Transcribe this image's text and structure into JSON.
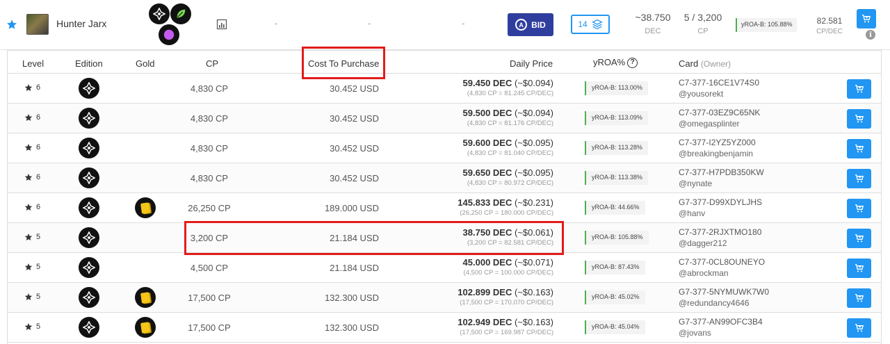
{
  "header": {
    "card_name": "Hunter Jarx",
    "dashes": [
      "-",
      "-",
      "-"
    ],
    "bid_label": "BID",
    "bid_badge": "A",
    "stack_count": "14",
    "price_dec": "~38.750",
    "price_dec_unit": "DEC",
    "cp_progress": "5 / 3,200",
    "cp_unit": "CP",
    "yroa": "yROA-B: 105.88%",
    "cp_per_dec": "82.581",
    "cp_per_dec_unit": "CP/DEC",
    "info_glyph": "i"
  },
  "columns": {
    "level": "Level",
    "edition": "Edition",
    "gold": "Gold",
    "cp": "CP",
    "cost": "Cost To Purchase",
    "daily_price": "Daily Price",
    "yroa": "yROA%",
    "yroa_help": "?",
    "card": "Card",
    "owner": "(Owner)"
  },
  "rows": [
    {
      "level": "6",
      "gold": false,
      "cp": "4,830 CP",
      "cost": "30.452 USD",
      "price": "59.450 DEC",
      "usd": "(~$0.094)",
      "sub": "(4,830 CP = 81.245 CP/DEC)",
      "yroa": "yROA-B: 113.00%",
      "card": "C7-377-16CE1V74S0",
      "owner": "@yousorekt"
    },
    {
      "level": "6",
      "gold": false,
      "cp": "4,830 CP",
      "cost": "30.452 USD",
      "price": "59.500 DEC",
      "usd": "(~$0.094)",
      "sub": "(4,830 CP = 81.176 CP/DEC)",
      "yroa": "yROA-B: 113.09%",
      "card": "C7-377-03EZ9C65NK",
      "owner": "@omegasplinter"
    },
    {
      "level": "6",
      "gold": false,
      "cp": "4,830 CP",
      "cost": "30.452 USD",
      "price": "59.600 DEC",
      "usd": "(~$0.095)",
      "sub": "(4,830 CP = 81.040 CP/DEC)",
      "yroa": "yROA-B: 113.28%",
      "card": "C7-377-I2YZ5YZ000",
      "owner": "@breakingbenjamin"
    },
    {
      "level": "6",
      "gold": false,
      "cp": "4,830 CP",
      "cost": "30.452 USD",
      "price": "59.650 DEC",
      "usd": "(~$0.095)",
      "sub": "(4,830 CP = 80.972 CP/DEC)",
      "yroa": "yROA-B: 113.38%",
      "card": "C7-377-H7PDB350KW",
      "owner": "@nynate"
    },
    {
      "level": "6",
      "gold": true,
      "cp": "26,250 CP",
      "cost": "189.000 USD",
      "price": "145.833 DEC",
      "usd": "(~$0.231)",
      "sub": "(26,250 CP = 180.000 CP/DEC)",
      "yroa": "yROA-B: 44.66%",
      "card": "G7-377-D99XDYLJHS",
      "owner": "@hanv"
    },
    {
      "level": "5",
      "gold": false,
      "cp": "3,200 CP",
      "cost": "21.184 USD",
      "price": "38.750 DEC",
      "usd": "(~$0.061)",
      "sub": "(3,200 CP = 82.581 CP/DEC)",
      "yroa": "yROA-B: 105.88%",
      "card": "C7-377-2RJXTMO180",
      "owner": "@dagger212"
    },
    {
      "level": "5",
      "gold": false,
      "cp": "4,500 CP",
      "cost": "21.184 USD",
      "price": "45.000 DEC",
      "usd": "(~$0.071)",
      "sub": "(4,500 CP = 100.000 CP/DEC)",
      "yroa": "yROA-B: 87.43%",
      "card": "C7-377-0CL8OUNEYO",
      "owner": "@abrockman"
    },
    {
      "level": "5",
      "gold": true,
      "cp": "17,500 CP",
      "cost": "132.300 USD",
      "price": "102.899 DEC",
      "usd": "(~$0.163)",
      "sub": "(17,500 CP = 170.070 CP/DEC)",
      "yroa": "yROA-B: 45.02%",
      "card": "G7-377-5NYMUWK7W0",
      "owner": "@redundancy4646"
    },
    {
      "level": "5",
      "gold": true,
      "cp": "17,500 CP",
      "cost": "132.300 USD",
      "price": "102.949 DEC",
      "usd": "(~$0.163)",
      "sub": "(17,500 CP = 169.987 CP/DEC)",
      "yroa": "yROA-B: 45.04%",
      "card": "G7-377-AN99OFC3B4",
      "owner": "@jovans"
    }
  ],
  "colors": {
    "accent": "#2196f3",
    "bid": "#2f3e9e",
    "highlight": "#e31b1b",
    "yroa_bar": "#4caf50",
    "gold": "#f5c518"
  }
}
